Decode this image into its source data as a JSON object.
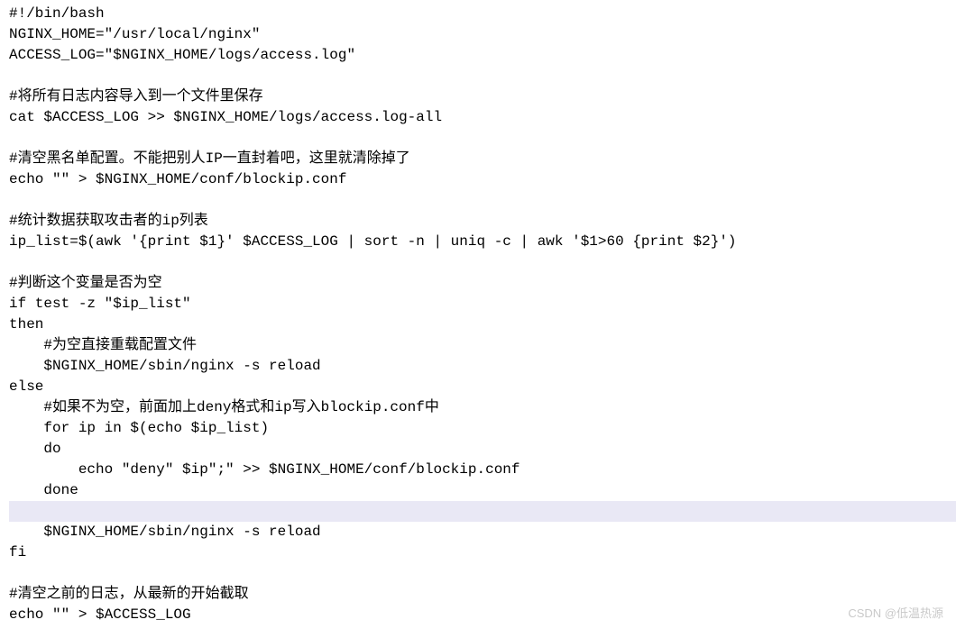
{
  "code": {
    "lines": [
      {
        "text": "#!/bin/bash",
        "hl": false
      },
      {
        "text": "NGINX_HOME=\"/usr/local/nginx\"",
        "hl": false
      },
      {
        "text": "ACCESS_LOG=\"$NGINX_HOME/logs/access.log\"",
        "hl": false
      },
      {
        "text": "",
        "hl": false
      },
      {
        "text": "#将所有日志内容导入到一个文件里保存",
        "hl": false
      },
      {
        "text": "cat $ACCESS_LOG >> $NGINX_HOME/logs/access.log-all",
        "hl": false
      },
      {
        "text": "",
        "hl": false
      },
      {
        "text": "#清空黑名单配置。不能把别人IP一直封着吧，这里就清除掉了",
        "hl": false
      },
      {
        "text": "echo \"\" > $NGINX_HOME/conf/blockip.conf",
        "hl": false
      },
      {
        "text": "",
        "hl": false
      },
      {
        "text": "#统计数据获取攻击者的ip列表",
        "hl": false
      },
      {
        "text": "ip_list=$(awk '{print $1}' $ACCESS_LOG | sort -n | uniq -c | awk '$1>60 {print $2}')",
        "hl": false
      },
      {
        "text": "",
        "hl": false
      },
      {
        "text": "#判断这个变量是否为空",
        "hl": false
      },
      {
        "text": "if test -z \"$ip_list\"",
        "hl": false
      },
      {
        "text": "then",
        "hl": false
      },
      {
        "text": "    #为空直接重载配置文件",
        "hl": false
      },
      {
        "text": "    $NGINX_HOME/sbin/nginx -s reload",
        "hl": false
      },
      {
        "text": "else",
        "hl": false
      },
      {
        "text": "    #如果不为空，前面加上deny格式和ip写入blockip.conf中",
        "hl": false
      },
      {
        "text": "    for ip in $(echo $ip_list)",
        "hl": false
      },
      {
        "text": "    do",
        "hl": false
      },
      {
        "text": "        echo \"deny\" $ip\";\" >> $NGINX_HOME/conf/blockip.conf",
        "hl": false
      },
      {
        "text": "    done",
        "hl": false
      },
      {
        "text": "",
        "hl": true
      },
      {
        "text": "    $NGINX_HOME/sbin/nginx -s reload",
        "hl": false
      },
      {
        "text": "fi",
        "hl": false
      },
      {
        "text": "",
        "hl": false
      },
      {
        "text": "#清空之前的日志，从最新的开始截取",
        "hl": false
      },
      {
        "text": "echo \"\" > $ACCESS_LOG",
        "hl": false
      }
    ]
  },
  "watermark": "CSDN @低温热源"
}
